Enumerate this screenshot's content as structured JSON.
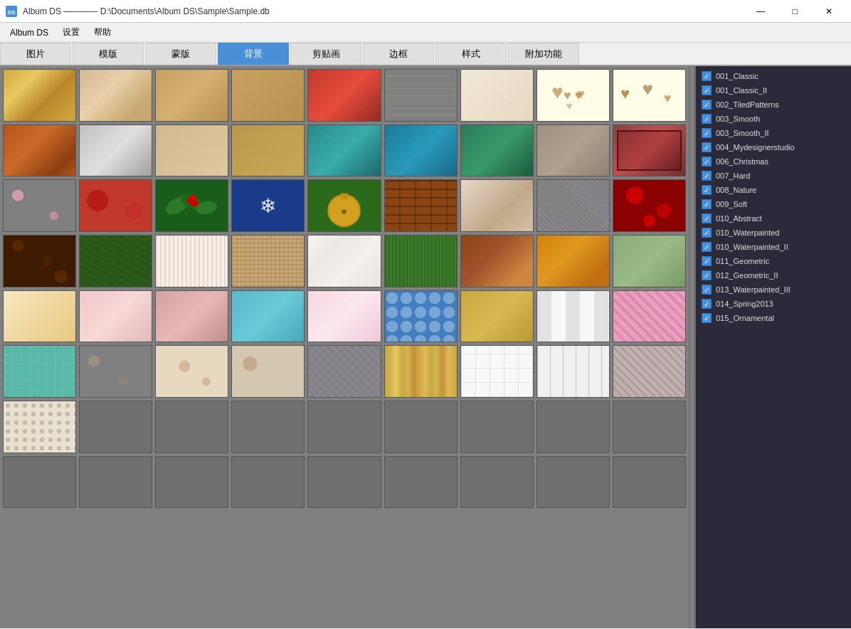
{
  "titleBar": {
    "icon": "DS",
    "title": "Album DS ———— D:\\Documents\\Album DS\\Sample\\Sample.db",
    "minimize": "—",
    "maximize": "□",
    "close": "✕"
  },
  "menuBar": {
    "items": [
      "Album DS",
      "设置",
      "帮助"
    ]
  },
  "tabs": [
    {
      "label": "图片",
      "active": false
    },
    {
      "label": "模版",
      "active": false
    },
    {
      "label": "蒙版",
      "active": false
    },
    {
      "label": "背景",
      "active": true
    },
    {
      "label": "剪贴画",
      "active": false
    },
    {
      "label": "边框",
      "active": false
    },
    {
      "label": "样式",
      "active": false
    },
    {
      "label": "附加功能",
      "active": false
    }
  ],
  "sidebar": {
    "items": [
      {
        "label": "001_Classic",
        "checked": true
      },
      {
        "label": "001_Classic_II",
        "checked": true
      },
      {
        "label": "002_TiledPatterns",
        "checked": true
      },
      {
        "label": "003_Smooth",
        "checked": true
      },
      {
        "label": "003_Smooth_II",
        "checked": true
      },
      {
        "label": "004_Mydesignerstudio",
        "checked": true
      },
      {
        "label": "006_Christmas",
        "checked": true
      },
      {
        "label": "007_Hard",
        "checked": true
      },
      {
        "label": "008_Nature",
        "checked": true
      },
      {
        "label": "009_Soft",
        "checked": true
      },
      {
        "label": "010_Abstract",
        "checked": true
      },
      {
        "label": "010_Waterpainted",
        "checked": true
      },
      {
        "label": "010_Waterpainted_II",
        "checked": true
      },
      {
        "label": "011_Geometric",
        "checked": true
      },
      {
        "label": "012_Geometric_II",
        "checked": true
      },
      {
        "label": "013_Waterpainted_III",
        "checked": true
      },
      {
        "label": "014_Spring2013",
        "checked": true
      },
      {
        "label": "015_Ornamental",
        "checked": true
      }
    ]
  },
  "grid": {
    "rows": 9,
    "cols": 9
  }
}
